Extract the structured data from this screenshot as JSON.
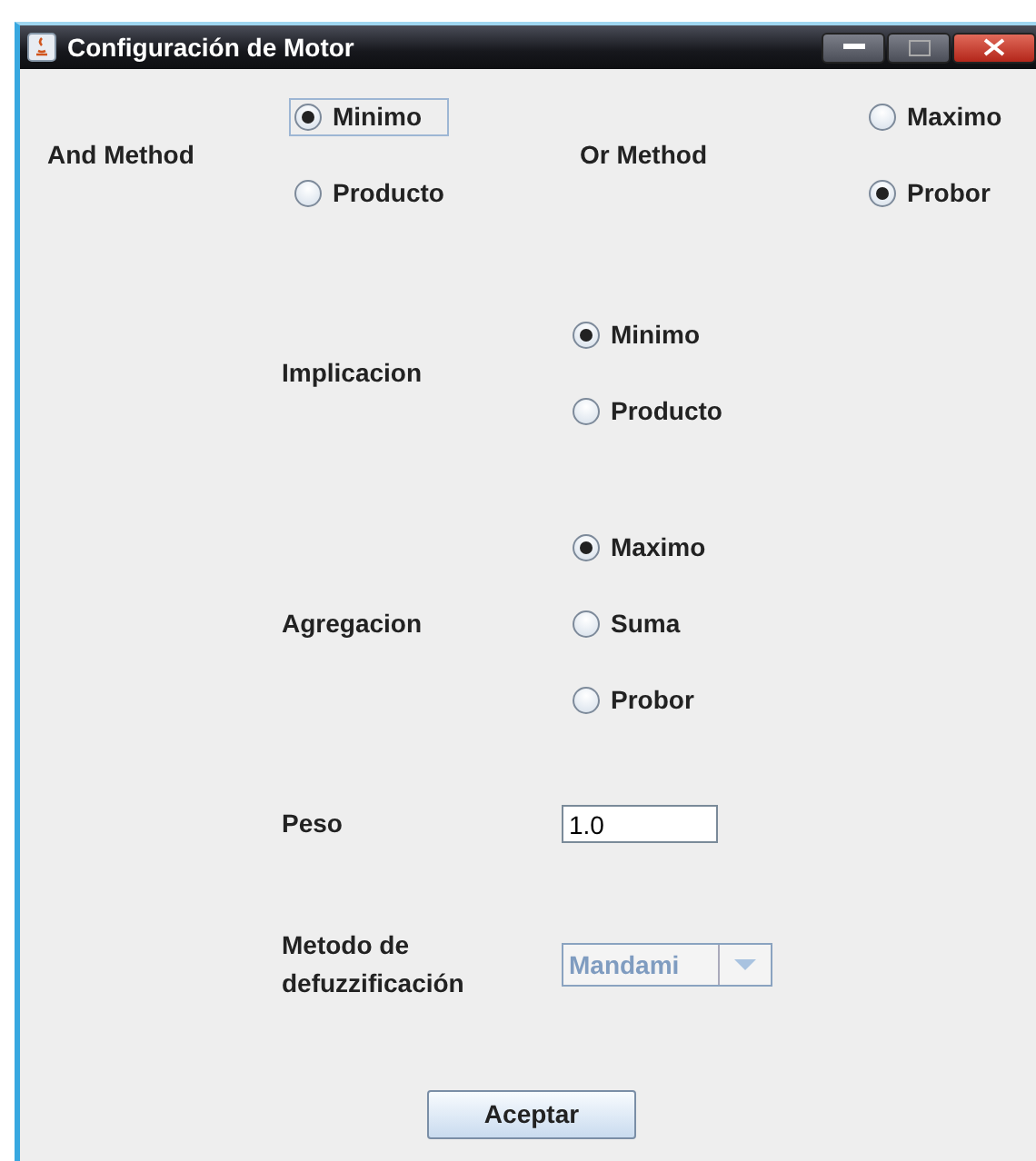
{
  "window": {
    "title": "Configuración de Motor"
  },
  "groups": [
    {
      "label": "And Method",
      "options": [
        {
          "label": "Minimo",
          "selected": true,
          "focused": true
        },
        {
          "label": "Producto",
          "selected": false,
          "focused": false
        }
      ]
    },
    {
      "label": "Or Method",
      "options": [
        {
          "label": "Maximo",
          "selected": false,
          "focused": false
        },
        {
          "label": "Probor",
          "selected": true,
          "focused": false
        }
      ]
    },
    {
      "label": "Implicacion",
      "options": [
        {
          "label": "Minimo",
          "selected": true,
          "focused": false
        },
        {
          "label": "Producto",
          "selected": false,
          "focused": false
        }
      ]
    },
    {
      "label": "Agregacion",
      "options": [
        {
          "label": "Maximo",
          "selected": true,
          "focused": false
        },
        {
          "label": "Suma",
          "selected": false,
          "focused": false
        },
        {
          "label": "Probor",
          "selected": false,
          "focused": false
        }
      ]
    }
  ],
  "weight": {
    "label": "Peso",
    "value": "1.0"
  },
  "defuzzification": {
    "label": "Metodo de defuzzificación",
    "value": "Mandami",
    "disabled": true
  },
  "buttons": [
    "Aceptar"
  ]
}
